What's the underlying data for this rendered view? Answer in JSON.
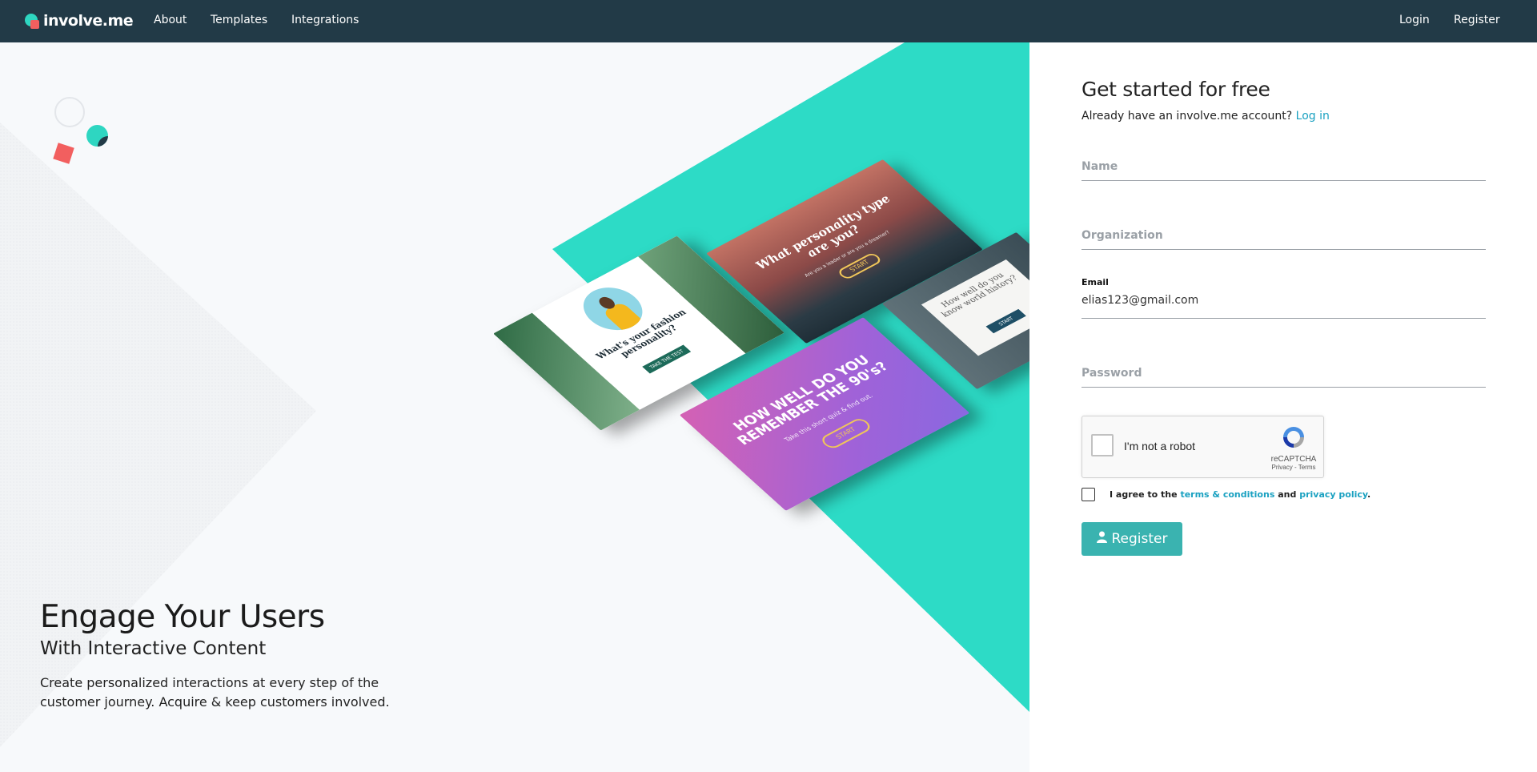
{
  "nav": {
    "logo_text": "involve.me",
    "links": [
      {
        "label": "About"
      },
      {
        "label": "Templates"
      },
      {
        "label": "Integrations"
      }
    ],
    "right_links": [
      {
        "label": "Login"
      },
      {
        "label": "Register"
      }
    ]
  },
  "hero": {
    "title": "Engage Your Users",
    "subtitle": "With Interactive Content",
    "description": "Create personalized interactions at every step of the customer journey. Acquire & keep customers involved.",
    "cards": [
      {
        "title": "What's your fashion personality?",
        "button": "TAKE THE TEST"
      },
      {
        "title": "What personality type are you?",
        "subtitle": "Are you a leader or are you a dreamer?",
        "button": "START"
      },
      {
        "title": "HOW WELL DO YOU REMEMBER THE 90's?",
        "subtitle": "Take this short quiz & find out.",
        "button": "START"
      },
      {
        "title": "How well do you know world history?",
        "button": "START"
      }
    ]
  },
  "form": {
    "title": "Get started for free",
    "account_prompt": "Already have an involve.me account?",
    "login_link": "Log in",
    "name_placeholder": "Name",
    "organization_placeholder": "Organization",
    "email_label": "Email",
    "email_value": "elias123@gmail.com",
    "password_placeholder": "Password",
    "captcha_label": "I'm not a robot",
    "captcha_brand": "reCAPTCHA",
    "captcha_links": "Privacy - Terms",
    "agree_prefix": "I agree to the",
    "terms_link": "terms & conditions",
    "agree_and": "and",
    "privacy_link": "privacy policy",
    "agree_suffix": ".",
    "register_label": "Register"
  },
  "colors": {
    "nav_bg": "#223a47",
    "accent_teal": "#2ed6c1",
    "button_teal": "#3ab3b0",
    "link_blue": "#1aa1c1",
    "coral": "#f25f5f"
  }
}
